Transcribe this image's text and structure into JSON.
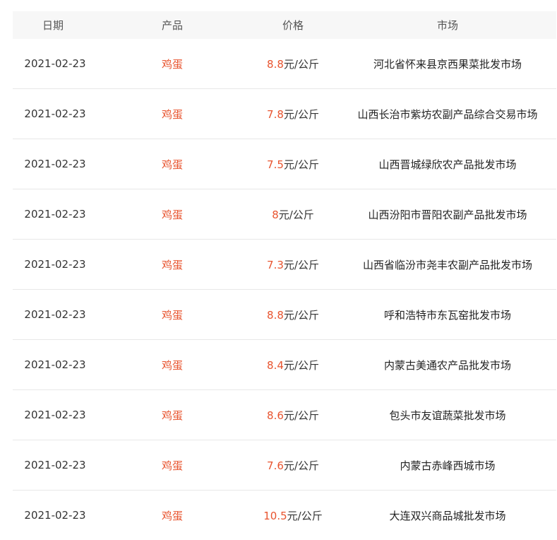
{
  "table": {
    "headers": {
      "date": "日期",
      "product": "产品",
      "price": "价格",
      "market": "市场"
    },
    "accent_color": "#e8542f",
    "rows": [
      {
        "date": "2021-02-23",
        "product": "鸡蛋",
        "price_value": "8.8",
        "price_unit": "元/公斤",
        "market": "河北省怀来县京西果菜批发市场"
      },
      {
        "date": "2021-02-23",
        "product": "鸡蛋",
        "price_value": "7.8",
        "price_unit": "元/公斤",
        "market": "山西长治市紫坊农副产品综合交易市场"
      },
      {
        "date": "2021-02-23",
        "product": "鸡蛋",
        "price_value": "7.5",
        "price_unit": "元/公斤",
        "market": "山西晋城绿欣农产品批发市场"
      },
      {
        "date": "2021-02-23",
        "product": "鸡蛋",
        "price_value": "8",
        "price_unit": "元/公斤",
        "market": "山西汾阳市晋阳农副产品批发市场"
      },
      {
        "date": "2021-02-23",
        "product": "鸡蛋",
        "price_value": "7.3",
        "price_unit": "元/公斤",
        "market": "山西省临汾市尧丰农副产品批发市场"
      },
      {
        "date": "2021-02-23",
        "product": "鸡蛋",
        "price_value": "8.8",
        "price_unit": "元/公斤",
        "market": "呼和浩特市东瓦窑批发市场"
      },
      {
        "date": "2021-02-23",
        "product": "鸡蛋",
        "price_value": "8.4",
        "price_unit": "元/公斤",
        "market": "内蒙古美通农产品批发市场"
      },
      {
        "date": "2021-02-23",
        "product": "鸡蛋",
        "price_value": "8.6",
        "price_unit": "元/公斤",
        "market": "包头市友谊蔬菜批发市场"
      },
      {
        "date": "2021-02-23",
        "product": "鸡蛋",
        "price_value": "7.6",
        "price_unit": "元/公斤",
        "market": "内蒙古赤峰西城市场"
      },
      {
        "date": "2021-02-23",
        "product": "鸡蛋",
        "price_value": "10.5",
        "price_unit": "元/公斤",
        "market": "大连双兴商品城批发市场"
      }
    ]
  }
}
